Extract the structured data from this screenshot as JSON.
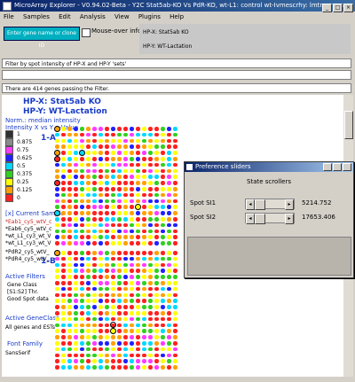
{
  "window": {
    "title": "MicroArray Explorer - V0.94.02-Beta - Y2C Stat5ab-KO Vs PdR-KO, wt-L1: control wt-Ivmescrhy: lmtr.arrays ..."
  },
  "menu": [
    "File",
    "Samples",
    "Edit",
    "Analysis",
    "View",
    "Plugins",
    "Help"
  ],
  "toolbar": {
    "gene_button": "Enter gene name or clone ID",
    "mouseover_label": "Mouse-over info",
    "hpx": "HP-X: Stat5ab KO",
    "hpy": "HP-Y: WT-Lactation"
  },
  "filter_text": "Filter by spot intensity of HP-X and HP-Y 'sets'",
  "status_text": "There are 414 genes passing the Filter.",
  "canvas": {
    "hpx": "HP-X: Stat5ab KO",
    "hpy": "HP-Y: WT-Lactation",
    "norm": "Norm.: median intensity",
    "intensity": "Intensity X vs Y p-Value",
    "legend": [
      {
        "label": "1",
        "color": "#303030"
      },
      {
        "label": "0.875",
        "color": "#8a8a8a"
      },
      {
        "label": "0.75",
        "color": "#ff3aff"
      },
      {
        "label": "0.625",
        "color": "#2020ff"
      },
      {
        "label": "0.5",
        "color": "#00d8ff"
      },
      {
        "label": "0.375",
        "color": "#30d020"
      },
      {
        "label": "0.25",
        "color": "#ffff00"
      },
      {
        "label": "0.125",
        "color": "#ffa000"
      },
      {
        "label": "0",
        "color": "#ff2020"
      }
    ],
    "label_1a": "1-A",
    "label_1b": "1-B",
    "current_sample": "[x] Current Sample",
    "samples": [
      "*Eab1_cy5_wtV_c",
      "*Eab6_cy5_wtV_c",
      "*wt_L1_cy3_wt_V",
      "*wt_L1_cy3_wt_V",
      "*PdR2_cy5_wtV_",
      "*PdR4_cy5_wtV_"
    ],
    "active_filters": "Active Filters",
    "filters": [
      "Gene Class",
      "[S1:S2] Thr.",
      "Good Spot data"
    ],
    "active_geneclass": "Active GeneClass",
    "geneclass_value": "All genes and ESTs",
    "font_family": "Font Family",
    "font_value": "SansSerif"
  },
  "dialog": {
    "title": "Preference sliders",
    "heading": "State scrollers",
    "spot1_label": "Spot SI1",
    "spot1_value": "5214.752",
    "spot2_label": "Spot SI2",
    "spot2_value": "17653.406"
  }
}
